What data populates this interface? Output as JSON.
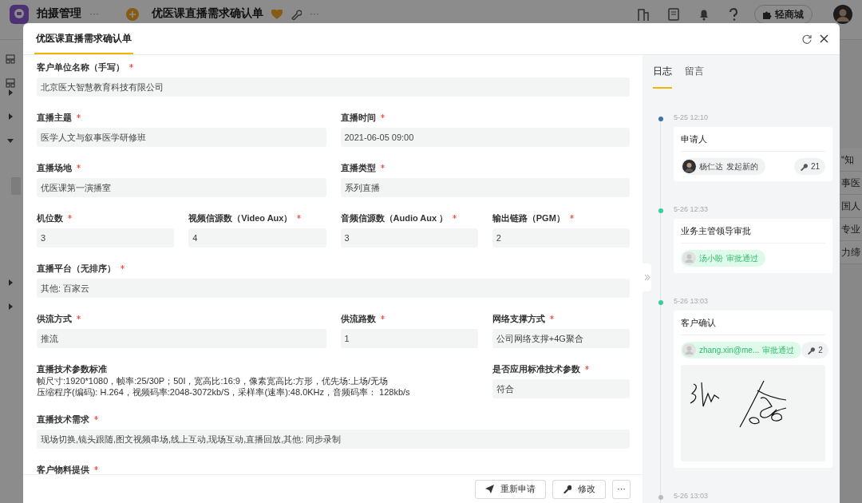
{
  "app_bar": {
    "app_name": "拍摄管理",
    "more": "···",
    "page_title": "优医课直播需求确认单",
    "page_more": "···",
    "shop_button": "轻商城"
  },
  "background_rows": [
    "“知",
    "事医",
    "国人",
    "专业",
    "力缔"
  ],
  "dialog": {
    "title": "优医课直播需求确认单",
    "form_rows": [
      {
        "fields": [
          {
            "label": "客户单位名称（手写）",
            "required": true,
            "value": "北京医大智慧教育科技有限公司"
          }
        ]
      },
      {
        "fields": [
          {
            "label": "直播主题",
            "required": true,
            "value": "医学人文与叙事医学研修班"
          },
          {
            "label": "直播时间",
            "required": true,
            "value": "2021-06-05 09:00"
          }
        ]
      },
      {
        "fields": [
          {
            "label": "直播场地",
            "required": true,
            "value": "优医课第一演播室"
          },
          {
            "label": "直播类型",
            "required": true,
            "value": "系列直播"
          }
        ]
      },
      {
        "fields": [
          {
            "label": "机位数",
            "required": true,
            "value": "3"
          },
          {
            "label": "视频信源数（Video Aux）",
            "required": true,
            "value": "4"
          },
          {
            "label": "音频信源数（Audio Aux ）",
            "required": true,
            "value": "3"
          },
          {
            "label": "输出链路（PGM）",
            "required": true,
            "value": "2"
          }
        ]
      },
      {
        "fields": [
          {
            "label": "直播平台（无排序）",
            "required": true,
            "value": "其他: 百家云"
          }
        ]
      },
      {
        "fields": [
          {
            "label": "供流方式",
            "required": true,
            "value": "推流"
          },
          {
            "label": "供流路数",
            "required": true,
            "value": "1"
          },
          {
            "label": "网络支撑方式",
            "required": true,
            "value": "公司网络支撑+4G聚合"
          }
        ]
      },
      {
        "fields": [
          {
            "label": "直播技术参数标准",
            "required": false,
            "kind": "note",
            "lines": [
              "帧尺寸:1920*1080，帧率:25/30P；50I，宽高比:16:9，像素宽高比:方形，优先场:上场/无场",
              "压缩程序(编码): H.264，视频码率:2048-3072kb/S，采样率(速率):48.0KHz，音频码率： 128kb/s"
            ]
          },
          {
            "label": "是否应用标准技术参数",
            "required": true,
            "value": "符合"
          }
        ]
      },
      {
        "fields": [
          {
            "label": "直播技术需求",
            "required": true,
            "value": "现场切换,镜头跟随,图文视频串场,线上互动,现场互动,直播回放,其他: 同步录制"
          }
        ]
      },
      {
        "fields": [
          {
            "label": "客户物料提供",
            "required": true
          }
        ]
      }
    ],
    "footer_buttons": [
      {
        "label": "重新申请",
        "kind": "send"
      },
      {
        "label": "修改",
        "kind": "wrench"
      },
      {
        "label": "···",
        "kind": "more"
      }
    ],
    "tabs": [
      {
        "label": "日志",
        "selected": true
      },
      {
        "label": "留言",
        "selected": false
      }
    ],
    "timeline": [
      {
        "time": "5-25 12:10",
        "color": "#3b6fb6",
        "title": "申请人",
        "chip": {
          "name": "杨仁达",
          "action": "发起新的",
          "kind": "started"
        },
        "count": "21"
      },
      {
        "time": "5-26 12:33",
        "color": "#36cf9a",
        "title": "业务主管领导审批",
        "chip": {
          "name": "汤小盼",
          "action": "审批通过",
          "kind": "approved"
        }
      },
      {
        "time": "5-26 13:03",
        "color": "#36cf9a",
        "title": "客户确认",
        "chip": {
          "name": "zhang.xin@me...",
          "action": "审批通过",
          "kind": "approved"
        },
        "count": "2",
        "attachment": {
          "kind": "signature"
        }
      },
      {
        "time": "5-26 13:03",
        "color": "#bbbbbb"
      }
    ]
  }
}
